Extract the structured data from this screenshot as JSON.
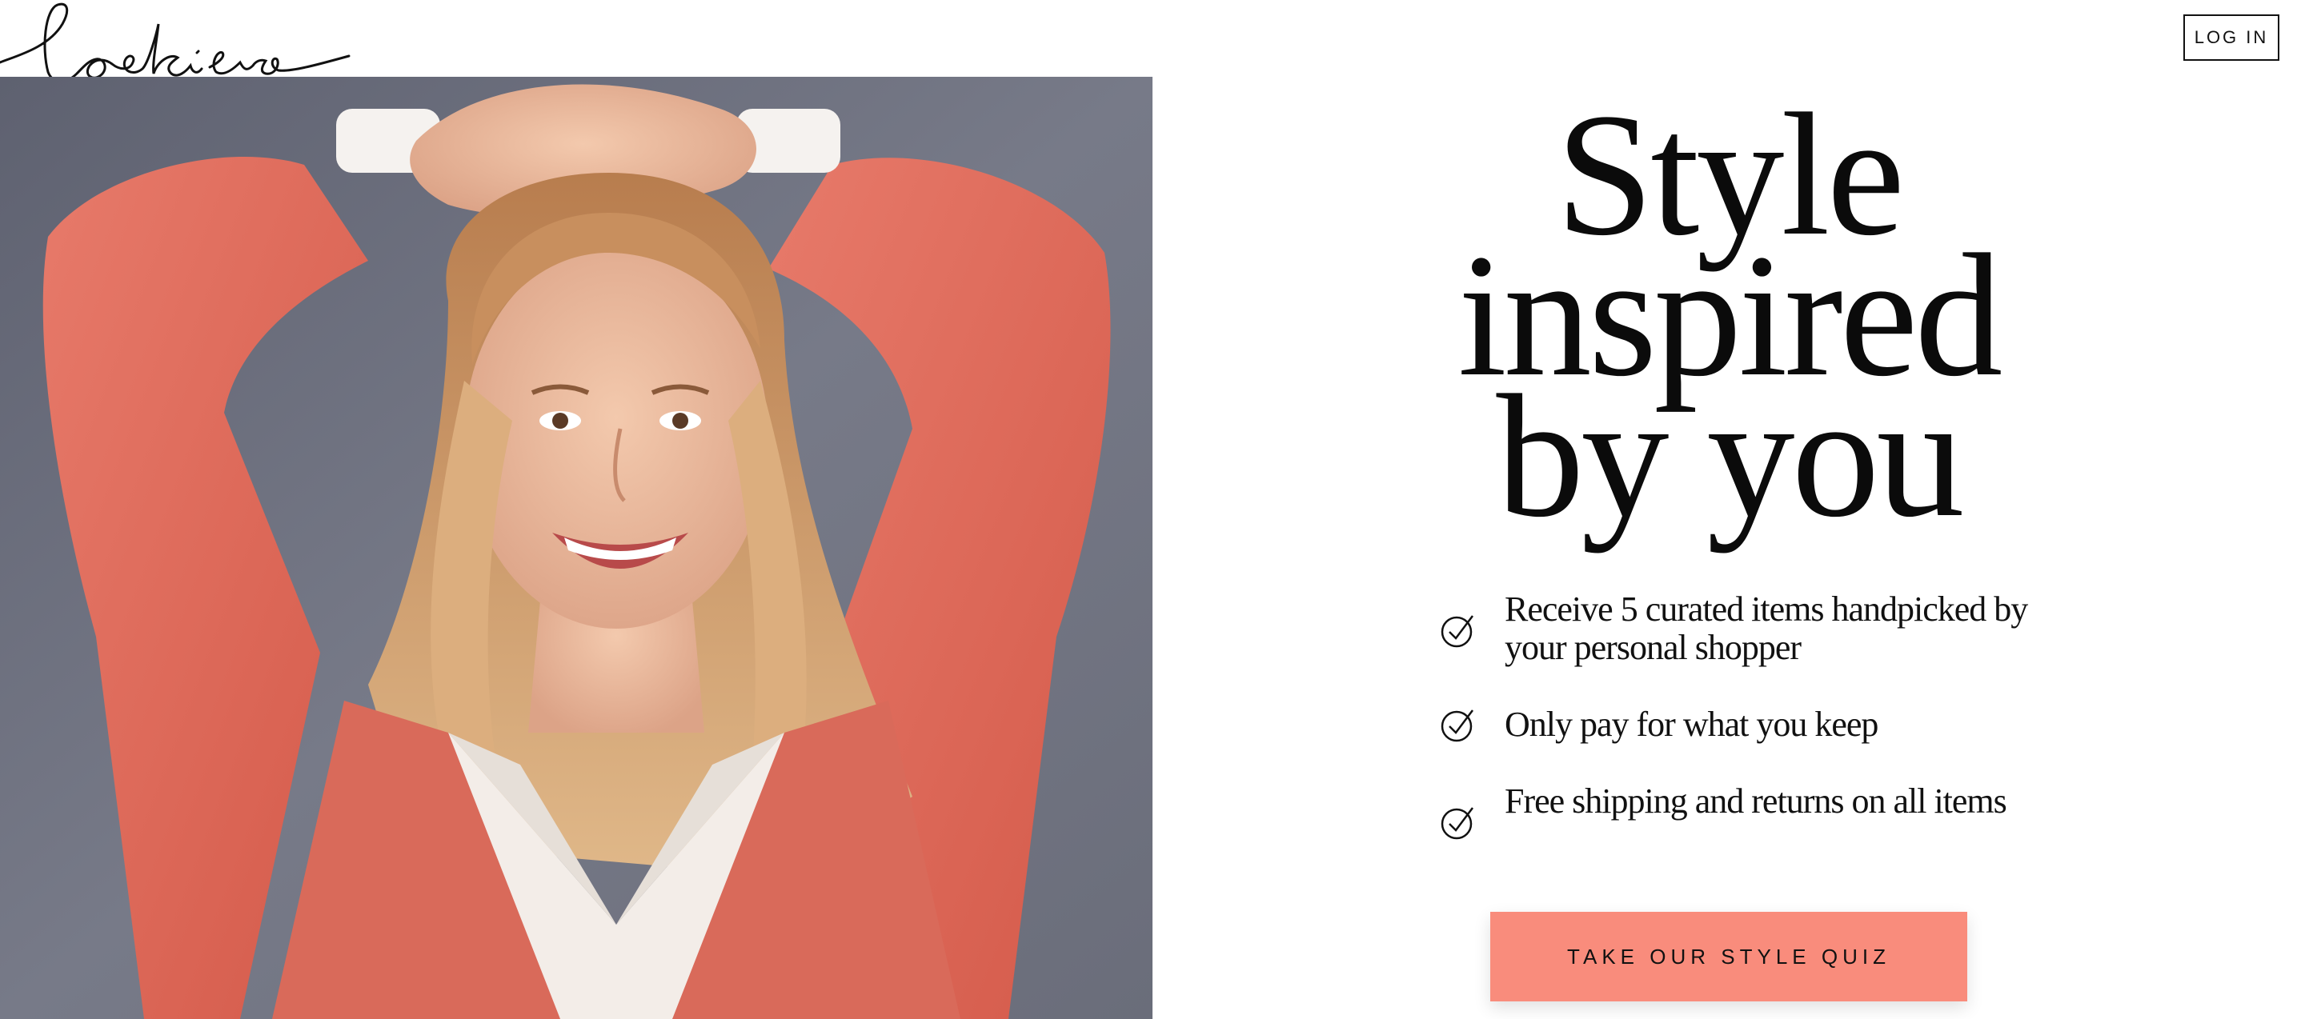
{
  "header": {
    "logo_text": "lookiero",
    "login_label": "LOG IN"
  },
  "hero": {
    "image_subject": "woman-in-coral-coat-smiling"
  },
  "headline": {
    "line1": "Style",
    "line2": "inspired",
    "line3": "by you"
  },
  "benefits": [
    {
      "text": "Receive 5 curated items handpicked by your personal shopper",
      "icon": "check-circle-icon"
    },
    {
      "text": "Only pay for what you keep",
      "icon": "check-circle-icon"
    },
    {
      "text": "Free shipping and returns on all items",
      "icon": "check-circle-icon"
    }
  ],
  "cta": {
    "label": "TAKE OUR STYLE QUIZ"
  },
  "colors": {
    "accent": "#f98c7c",
    "text": "#111111",
    "background": "#ffffff",
    "coat": "#e0695a",
    "wall": "#6b6f7c"
  }
}
